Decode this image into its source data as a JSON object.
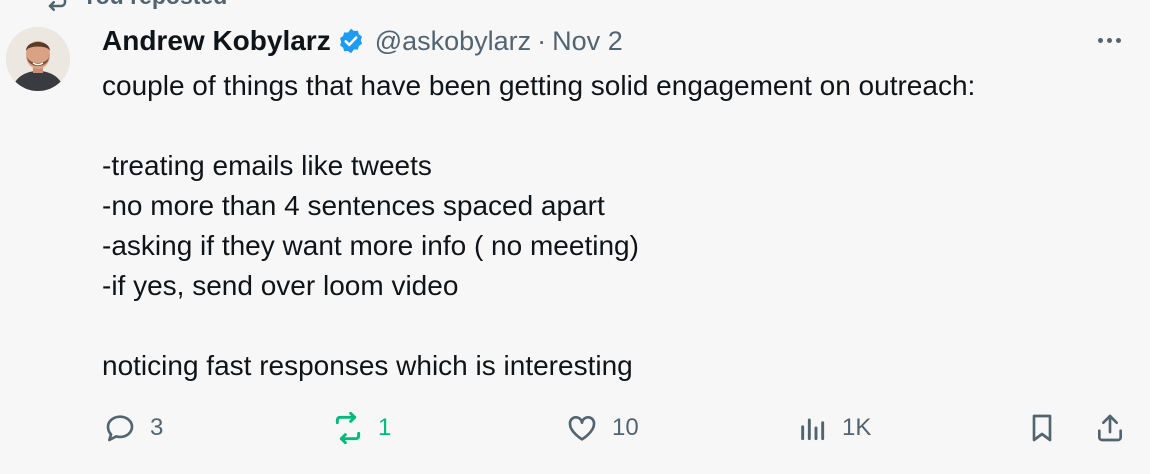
{
  "repost_banner": {
    "label": "You reposted",
    "icon": "repost-icon"
  },
  "tweet": {
    "author_name": "Andrew Kobylarz",
    "verified": true,
    "handle": "@askobylarz",
    "separator": "·",
    "date": "Nov 2",
    "lines": [
      "couple of things that have been getting solid engagement on outreach:",
      "",
      "-treating emails like tweets",
      "-no more than 4 sentences spaced apart",
      "-asking if they want more info ( no meeting)",
      "-if yes, send over loom video",
      "",
      "noticing fast responses which is interesting"
    ]
  },
  "actions": {
    "replies": "3",
    "reposts": "1",
    "likes": "10",
    "views": "1K"
  },
  "colors": {
    "background": "#f7f7f7",
    "text": "#0f1419",
    "muted": "#536471",
    "repost_active": "#00ba7c",
    "verified": "#1d9bf0"
  }
}
